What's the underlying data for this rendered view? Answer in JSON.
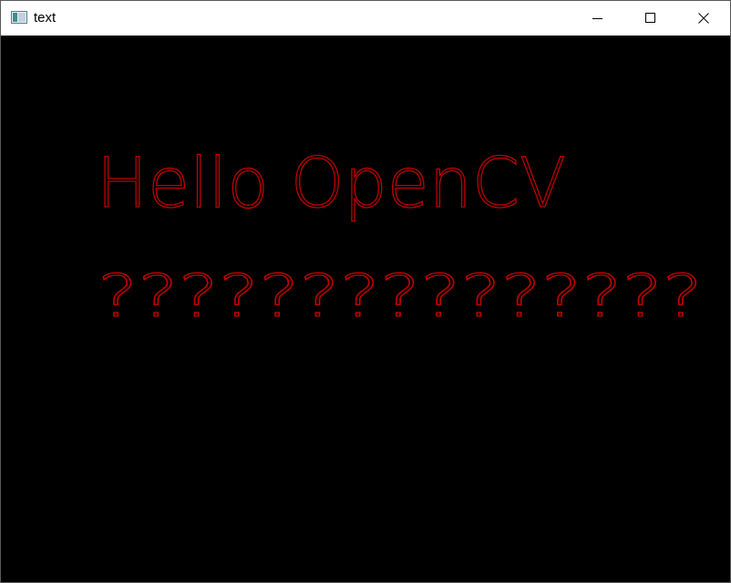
{
  "window": {
    "title": "text"
  },
  "canvas": {
    "background": "#000000",
    "text_color": "#c00000",
    "line1": "Hello OpenCV",
    "line2": "???????????????"
  },
  "icons": {
    "app": "opencv-window-icon",
    "minimize": "minimize-icon",
    "maximize": "maximize-icon",
    "close": "close-icon"
  }
}
